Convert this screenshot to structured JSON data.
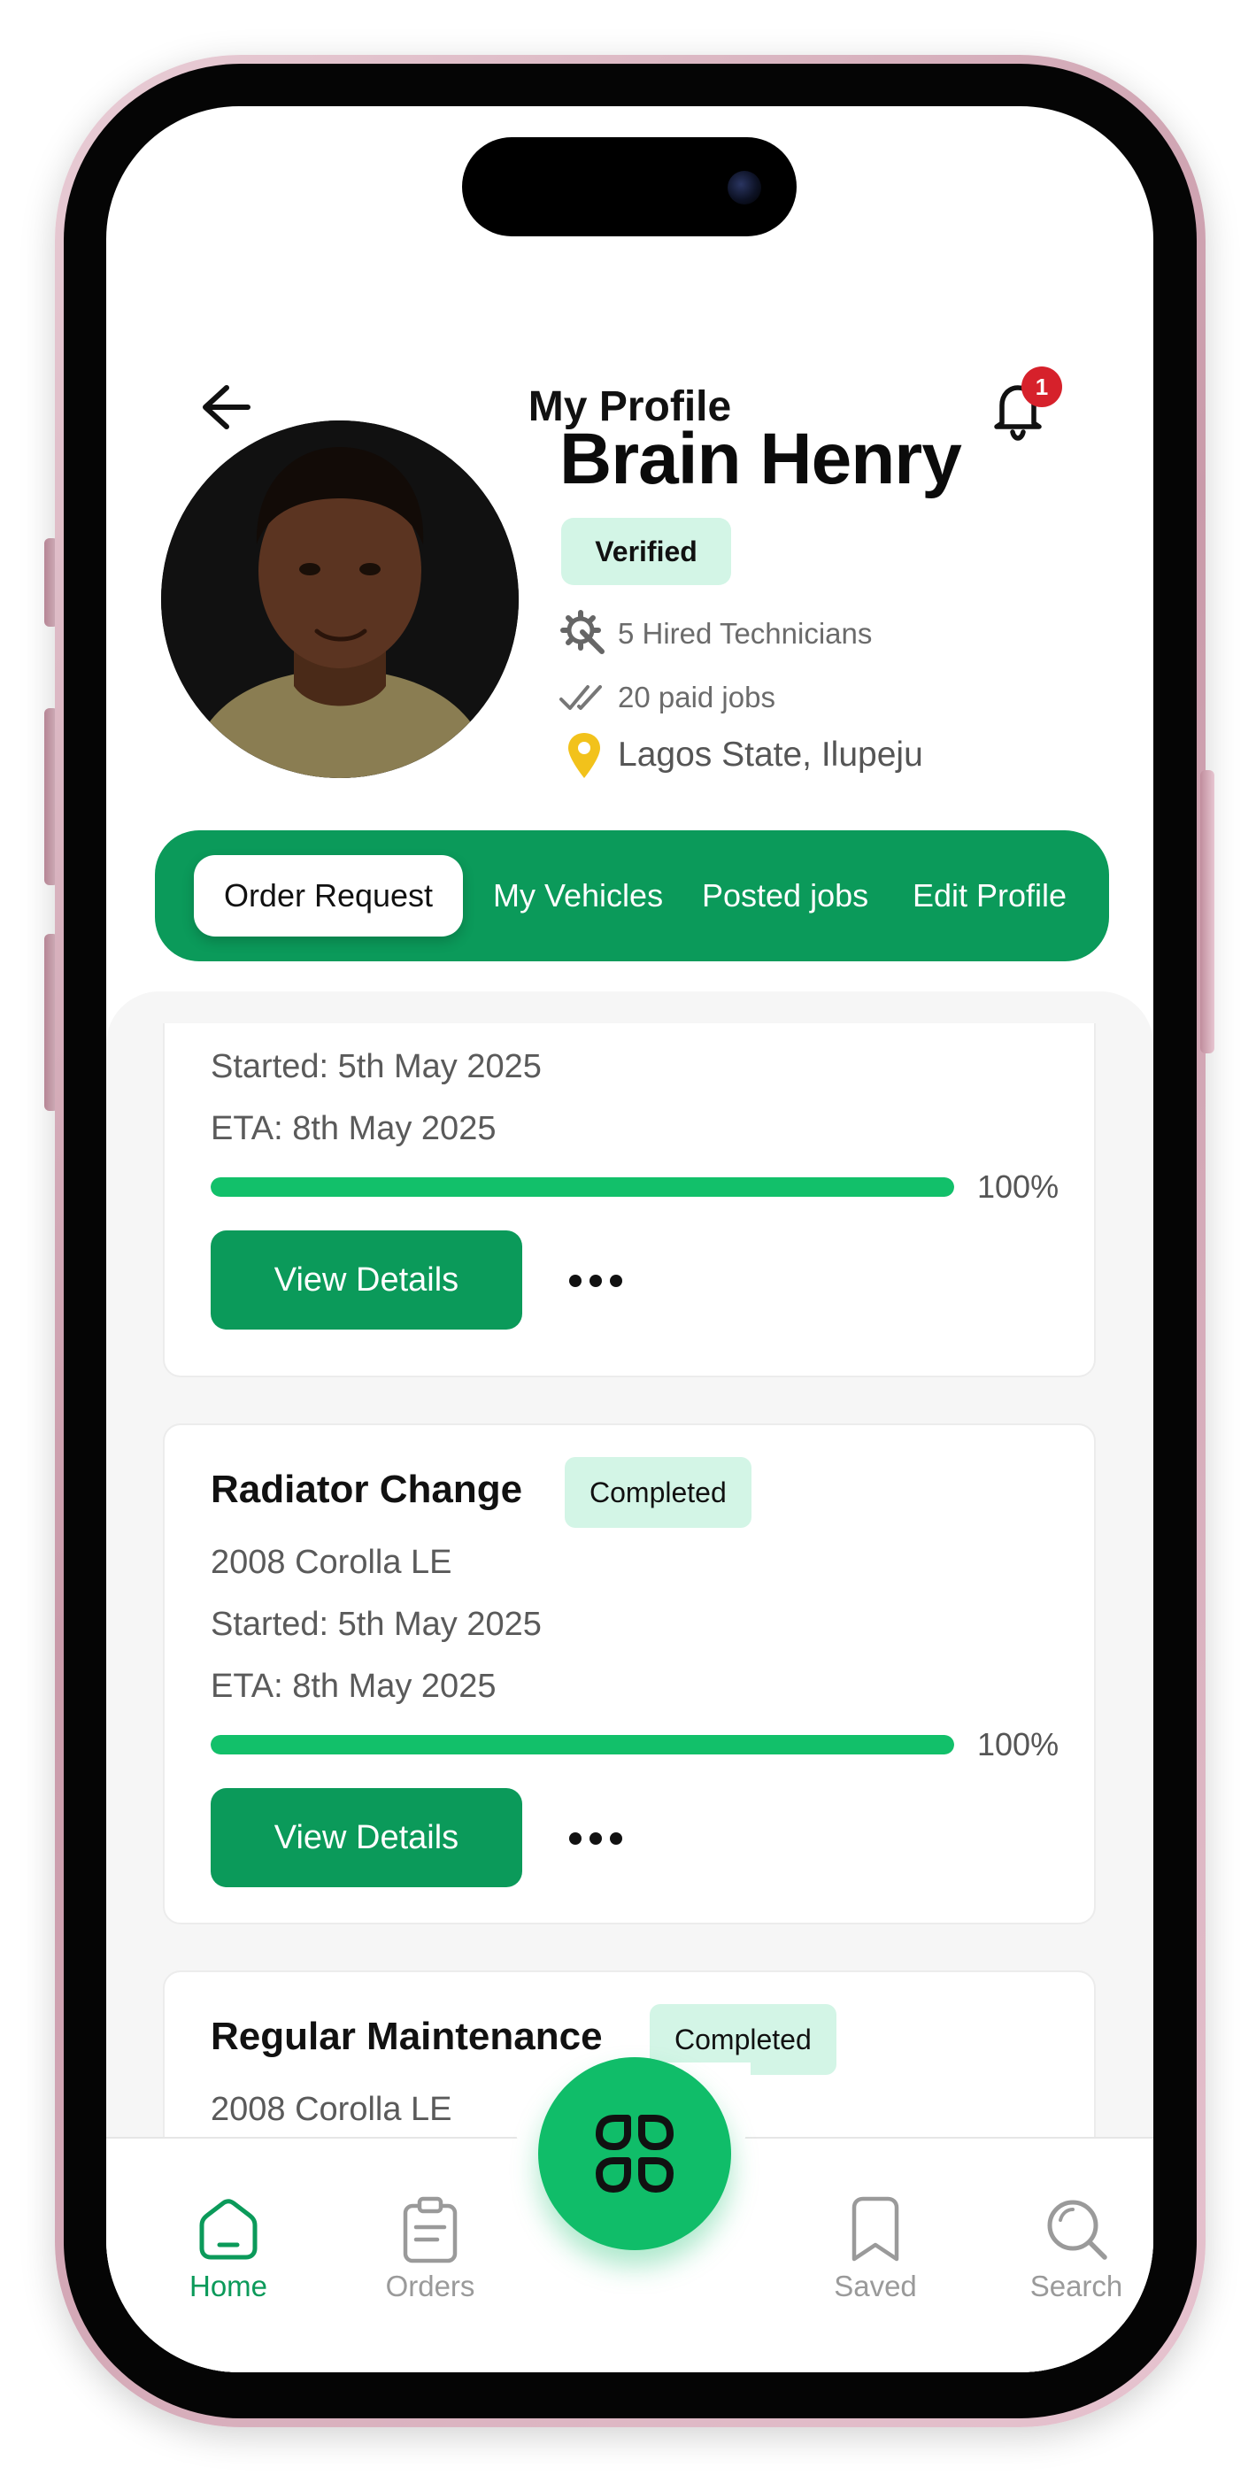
{
  "header": {
    "title": "My Profile",
    "notification_count": "1"
  },
  "profile": {
    "name": "Brain Henry",
    "verified_label": "Verified",
    "hired_technicians": "5 Hired Technicians",
    "paid_jobs": "20 paid jobs",
    "location": "Lagos State, Ilupeju"
  },
  "tabs": [
    {
      "label": "Order Request",
      "active": true
    },
    {
      "label": "My Vehicles",
      "active": false
    },
    {
      "label": "Posted jobs",
      "active": false
    },
    {
      "label": "Edit Profile",
      "active": false
    }
  ],
  "orders": [
    {
      "started": "Started: 5th May 2025",
      "eta": "ETA: 8th May 2025",
      "progress": 100,
      "progress_label": "100%",
      "button_label": "View Details"
    },
    {
      "title": "Radiator Change",
      "status": "Completed",
      "vehicle": "2008 Corolla LE",
      "started": "Started: 5th May 2025",
      "eta": "ETA: 8th May 2025",
      "progress": 100,
      "progress_label": "100%",
      "button_label": "View Details"
    },
    {
      "title": "Regular Maintenance",
      "status": "Completed",
      "vehicle": "2008 Corolla LE"
    }
  ],
  "bottom_nav": [
    {
      "label": "Home",
      "icon": "home-icon",
      "active": true
    },
    {
      "label": "Orders",
      "icon": "clipboard-icon",
      "active": false
    },
    {
      "label": "Saved",
      "icon": "bookmark-icon",
      "active": false
    },
    {
      "label": "Search",
      "icon": "search-icon",
      "active": false
    }
  ],
  "colors": {
    "brand_green": "#0b9a5a",
    "fab_green": "#10bd69",
    "badge_bg": "#d3f5e6",
    "notification_red": "#d6212b",
    "pin_yellow": "#f2c21b"
  }
}
